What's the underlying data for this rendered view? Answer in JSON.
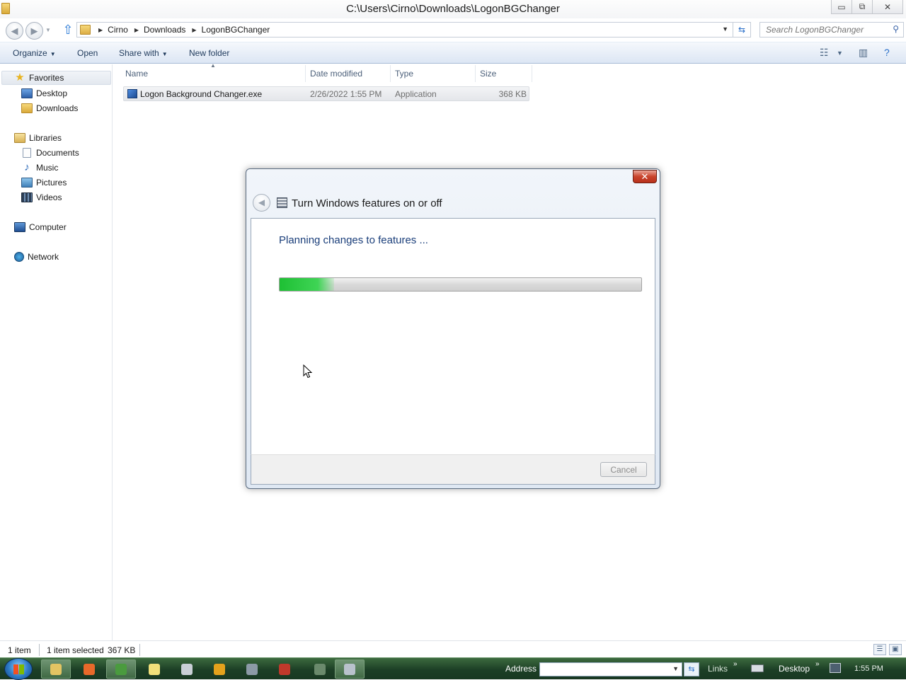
{
  "window": {
    "title": "C:\\Users\\Cirno\\Downloads\\LogonBGChanger",
    "controls": {
      "minimize": "▭",
      "restore": "⧉",
      "close": "✕"
    }
  },
  "address": {
    "crumbs": [
      "Cirno",
      "Downloads",
      "LogonBGChanger"
    ],
    "search_placeholder": "Search LogonBGChanger"
  },
  "toolbar": {
    "organize": "Organize",
    "open": "Open",
    "share_with": "Share with",
    "new_folder": "New folder"
  },
  "nav": {
    "favorites": "Favorites",
    "desktop": "Desktop",
    "downloads": "Downloads",
    "libraries": "Libraries",
    "documents": "Documents",
    "music": "Music",
    "pictures": "Pictures",
    "videos": "Videos",
    "computer": "Computer",
    "network": "Network"
  },
  "columns": {
    "name": "Name",
    "date": "Date modified",
    "type": "Type",
    "size": "Size"
  },
  "files": [
    {
      "name": "Logon Background Changer.exe",
      "date": "2/26/2022 1:55 PM",
      "type": "Application",
      "size": "368 KB"
    }
  ],
  "status": {
    "count": "1 item",
    "selection": "1 item selected",
    "selection_size": "367 KB"
  },
  "dialog": {
    "title": "Turn Windows features on or off",
    "heading": "Planning changes to features ...",
    "progress": 0.15,
    "cancel": "Cancel",
    "close": "✕"
  },
  "taskbar": {
    "address_label": "Address",
    "links": "Links",
    "desktop": "Desktop",
    "clock": "1:55 PM",
    "apps": [
      {
        "name": "explorer",
        "color": "#e3c463",
        "active": true
      },
      {
        "name": "firefox",
        "color": "#e8692a",
        "active": false
      },
      {
        "name": "chrome",
        "color": "#4a9b3e",
        "active": true
      },
      {
        "name": "notepad",
        "color": "#f1e07a",
        "active": false
      },
      {
        "name": "printer",
        "color": "#c9cfd6",
        "active": false
      },
      {
        "name": "media",
        "color": "#e4a21c",
        "active": false
      },
      {
        "name": "tool",
        "color": "#8c9aa6",
        "active": false
      },
      {
        "name": "app-red",
        "color": "#c0392b",
        "active": false
      },
      {
        "name": "blank",
        "color": "#6a8a6c",
        "active": false
      },
      {
        "name": "features",
        "color": "#b9c2cc",
        "active": true
      }
    ]
  }
}
